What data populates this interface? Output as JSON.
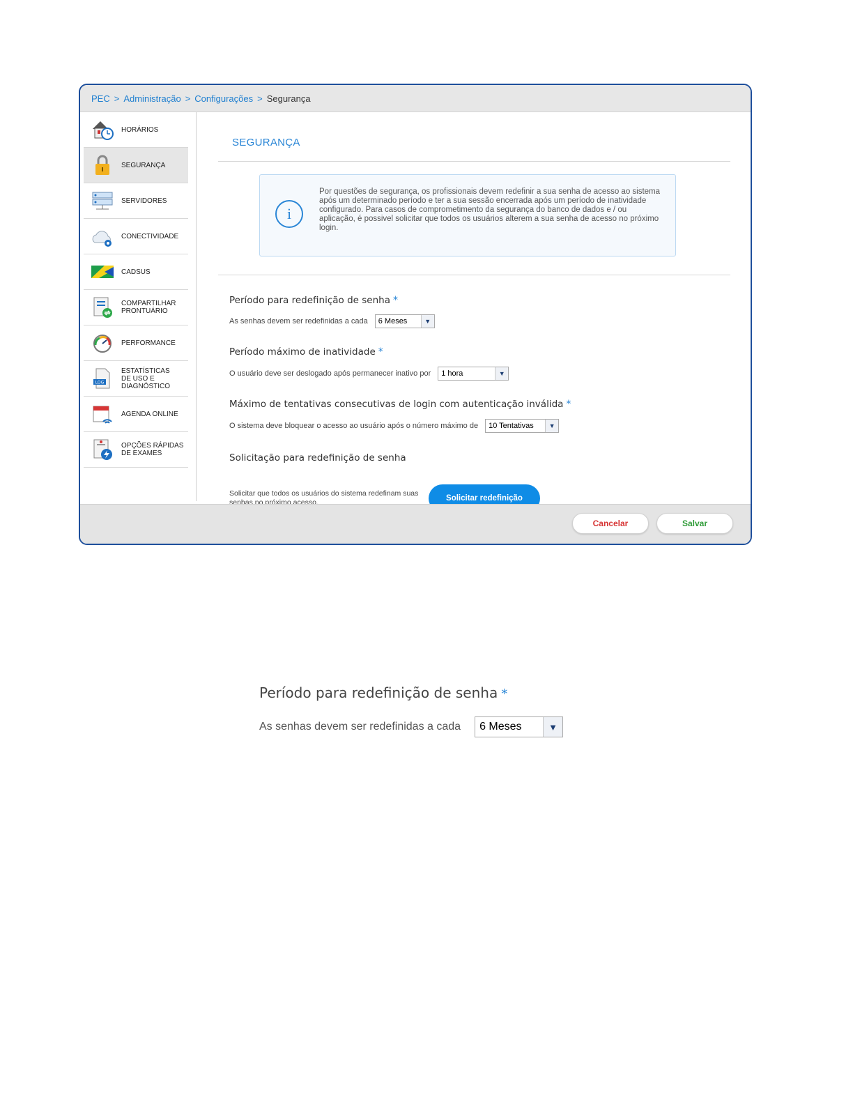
{
  "breadcrumb": [
    {
      "label": "PEC",
      "link": true
    },
    {
      "label": "Administração",
      "link": true
    },
    {
      "label": "Configurações",
      "link": true
    },
    {
      "label": "Segurança",
      "link": false
    }
  ],
  "breadcrumb_separator": ">",
  "sidebar": {
    "items": [
      {
        "label": "HORÁRIOS",
        "icon": "clock-house-icon",
        "active": false
      },
      {
        "label": "SEGURANÇA",
        "icon": "lock-icon",
        "active": true
      },
      {
        "label": "SERVIDORES",
        "icon": "server-icon",
        "active": false
      },
      {
        "label": "CONECTIVIDADE",
        "icon": "cloud-gear-icon",
        "active": false
      },
      {
        "label": "CADSUS",
        "icon": "cadsus-flag-icon",
        "active": false
      },
      {
        "label": "COMPARTILHAR\nPRONTUÁRIO",
        "icon": "share-document-icon",
        "active": false
      },
      {
        "label": "PERFORMANCE",
        "icon": "gauge-icon",
        "active": false
      },
      {
        "label": "ESTATÍSTICAS\nDE USO E\nDIAGNÓSTICO",
        "icon": "log-file-icon",
        "active": false
      },
      {
        "label": "AGENDA ONLINE",
        "icon": "calendar-wifi-icon",
        "active": false
      },
      {
        "label": "OPÇÕES RÁPIDAS\nDE EXAMES",
        "icon": "exam-lightning-icon",
        "active": false
      }
    ]
  },
  "main": {
    "title": "SEGURANÇA",
    "info_text": "Por questões de segurança, os profissionais devem redefinir a sua senha de acesso ao sistema após um determinado período e ter a sua sessão encerrada após um período de inatividade configurado. Para casos de comprometimento da segurança do banco de dados e / ou aplicação, é possivel solicitar que todos os usuários alterem a sua senha de acesso no próximo login.",
    "sections": {
      "password_period": {
        "title": "Período para redefinição de senha",
        "required": "*",
        "label": "As senhas devem ser redefinidas a cada",
        "value": "6 Meses"
      },
      "inactivity": {
        "title": "Período máximo de inatividade",
        "required": "*",
        "label": "O usuário deve ser deslogado após permanecer inativo por",
        "value": "1 hora"
      },
      "login_attempts": {
        "title": "Máximo de tentativas consecutivas de login com autenticação inválida",
        "required": "*",
        "label": "O sistema deve bloquear o acesso ao usuário após o número máximo de",
        "value": "10 Tentativas"
      },
      "reset_request": {
        "title": "Solicitação para redefinição de senha",
        "description": "Solicitar que todos os usuários do sistema redefinam suas senhas no próximo acesso.",
        "button": "Solicitar redefinição"
      }
    }
  },
  "footer": {
    "cancel": "Cancelar",
    "save": "Salvar"
  },
  "zoom_detail": {
    "title": "Período para redefinição de senha",
    "required": "*",
    "label": "As senhas devem ser redefinidas a cada",
    "value": "6 Meses"
  },
  "colors": {
    "accent": "#2a86d6",
    "primary_button": "#0f8ce6",
    "cancel": "#d73535",
    "save": "#2e9b37",
    "frame": "#1e4f9c"
  }
}
